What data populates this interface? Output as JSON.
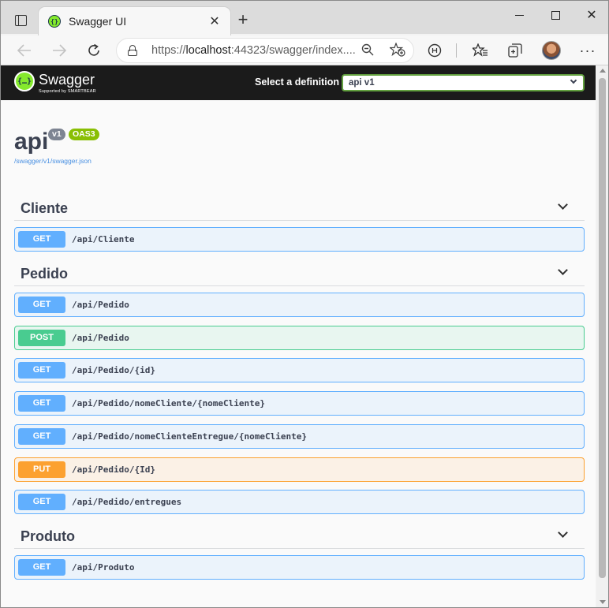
{
  "browser": {
    "tab_title": "Swagger UI",
    "tab_close": "✕",
    "new_tab": "+",
    "url_prefix": "https://",
    "url_host": "localhost",
    "url_rest": ":44323/swagger/index....",
    "icons": [
      "sidebar-tabs-icon",
      "swagger-favicon",
      "back-icon",
      "forward-icon",
      "reload-icon",
      "lock-icon",
      "zoom-icon",
      "add-favorite-icon",
      "extension-icon",
      "favorites-icon",
      "collections-icon",
      "avatar",
      "more-icon",
      "minimize-icon",
      "maximize-icon",
      "close-icon"
    ]
  },
  "swagger": {
    "brand": "Swagger",
    "brand_sub": "Supported by SMARTBEAR",
    "definition_label": "Select a definition",
    "definition_value": "api v1",
    "info": {
      "title": "api",
      "version": "v1",
      "oas": "OAS3",
      "spec_url": "/swagger/v1/swagger.json"
    },
    "tags": [
      {
        "name": "Cliente",
        "operations": [
          {
            "method": "GET",
            "path": "/api/Cliente"
          }
        ]
      },
      {
        "name": "Pedido",
        "operations": [
          {
            "method": "GET",
            "path": "/api/Pedido"
          },
          {
            "method": "POST",
            "path": "/api/Pedido"
          },
          {
            "method": "GET",
            "path": "/api/Pedido/{id}"
          },
          {
            "method": "GET",
            "path": "/api/Pedido/nomeCliente/{nomeCliente}"
          },
          {
            "method": "GET",
            "path": "/api/Pedido/nomeClienteEntregue/{nomeCliente}"
          },
          {
            "method": "PUT",
            "path": "/api/Pedido/{Id}"
          },
          {
            "method": "GET",
            "path": "/api/Pedido/entregues"
          }
        ]
      },
      {
        "name": "Produto",
        "operations": [
          {
            "method": "GET",
            "path": "/api/Produto"
          }
        ]
      }
    ],
    "colors": {
      "get": "#61affe",
      "post": "#49cc90",
      "put": "#fca130",
      "topbar": "#1b1b1b",
      "brand_green": "#85ea2d"
    }
  }
}
